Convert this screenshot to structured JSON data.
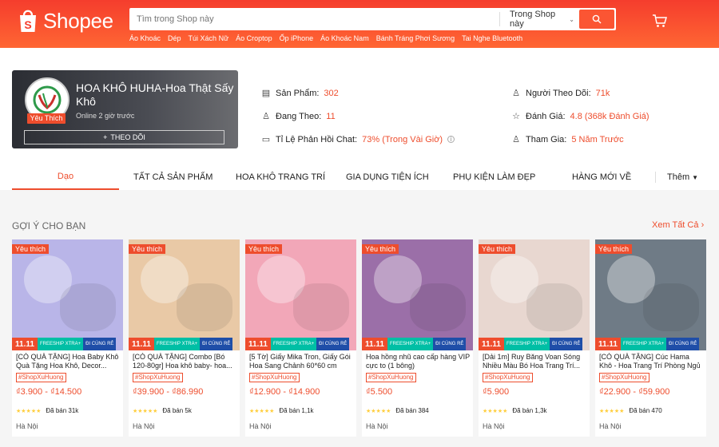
{
  "header": {
    "brand": "Shopee",
    "search_placeholder": "Tìm trong Shop này",
    "search_scope": "Trong Shop này",
    "suggestions": [
      "Áo Khoác",
      "Dép",
      "Túi Xách Nữ",
      "Áo Croptop",
      "Ốp iPhone",
      "Áo Khoác Nam",
      "Bánh Tráng Phơi Sương",
      "Tai Nghe Bluetooth"
    ],
    "accent": "#ee4d2d"
  },
  "shop": {
    "name": "HOA KHÔ HUHA-Hoa Thật Sấy Khô",
    "badge": "Yêu Thích",
    "online": "Online 2 giờ trước",
    "follow": "THEO DÕI",
    "stats_left": [
      {
        "icon": "store-icon",
        "label": "Sản Phẩm:",
        "value": "302"
      },
      {
        "icon": "user-icon",
        "label": "Đang Theo:",
        "value": "11"
      },
      {
        "icon": "chat-icon",
        "label": "Tỉ Lệ Phản Hồi Chat:",
        "value": "73% (Trong Vài Giờ)"
      }
    ],
    "stats_right": [
      {
        "icon": "followers-icon",
        "label": "Người Theo Dõi:",
        "value": "71k"
      },
      {
        "icon": "star-icon",
        "label": "Đánh Giá:",
        "value": "4.8 (368k Đánh Giá)"
      },
      {
        "icon": "joined-icon",
        "label": "Tham Gia:",
        "value": "5 Năm Trước"
      }
    ]
  },
  "tabs": [
    "Dạo",
    "TẤT CẢ SẢN PHẨM",
    "HOA KHÔ TRANG TRÍ",
    "GIA DỤNG TIỆN ÍCH",
    "PHỤ KIỆN LÀM ĐẸP",
    "HÀNG MỚI VỀ",
    "Thêm"
  ],
  "section": {
    "title": "GỢI Ý CHO BẠN",
    "see_all": "Xem Tất Cả"
  },
  "products": [
    {
      "fav": "Yêu thích",
      "promo": "11.11",
      "title": "[CÓ QUÀ TẶNG] Hoa Baby Khô Quà Tặng Hoa Khô, Decor...",
      "hashtag": "#ShopXuHuong",
      "price": "₫3.900 - ₫14.500",
      "sold": "Đã bán 31k",
      "location": "Hà Nội",
      "img_color": "#b9b5e8"
    },
    {
      "fav": "Yêu thích",
      "promo": "11.11",
      "title": "[CÓ QUÀ TẶNG] Combo [Bó 120-80gr] Hoa khô baby- hoa...",
      "hashtag": "#ShopXuHuong",
      "price": "₫39.900 - ₫86.990",
      "sold": "Đã bán 5k",
      "location": "Hà Nội",
      "img_color": "#e9c9a6"
    },
    {
      "fav": "Yêu thích",
      "promo": "11.11",
      "title": "[5 Tờ] Giấy Mika Tron, Giấy Gói Hoa Sang Chảnh 60*60 cm",
      "hashtag": "#ShopXuHuong",
      "price": "₫12.900 - ₫14.900",
      "sold": "Đã bán 1,1k",
      "location": "Hà Nội",
      "img_color": "#f2a7b8"
    },
    {
      "fav": "Yêu thích",
      "promo": "11.11",
      "title": "Hoa hồng nhũ cao cấp hàng VIP cực to (1 bông)",
      "hashtag": "#ShopXuHuong",
      "price": "₫5.500",
      "sold": "Đã bán 384",
      "location": "Hà Nội",
      "img_color": "#9b6fa8"
    },
    {
      "fav": "Yêu thích",
      "promo": "11.11",
      "title": "[Dải 1m] Ruy Băng Voan Sóng Nhiều Màu Bó Hoa Trang Trí...",
      "hashtag": "#ShopXuHuong",
      "price": "₫5.900",
      "sold": "Đã bán 1,3k",
      "location": "Hà Nội",
      "img_color": "#e8d7d0"
    },
    {
      "fav": "Yêu thích",
      "promo": "11.11",
      "title": "[CÓ QUÀ TẶNG] Cúc Hama Khô - Hoa Trang Trí Phòng Ngủ -...",
      "hashtag": "#ShopXuHuong",
      "price": "₫22.900 - ₫59.900",
      "sold": "Đã bán 470",
      "location": "Hà Nội",
      "img_color": "#6f7b86"
    }
  ]
}
